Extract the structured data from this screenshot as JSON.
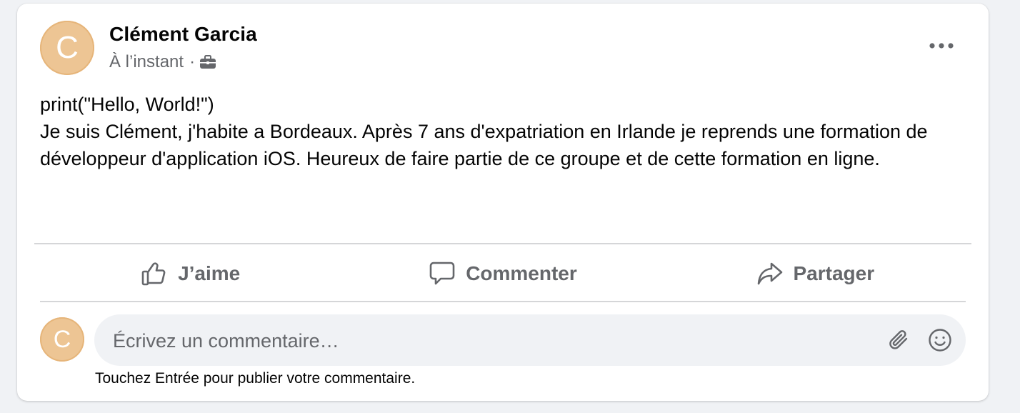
{
  "post": {
    "author": "Clément Garcia",
    "avatar_initial": "C",
    "timestamp": "À l’instant",
    "separator": "·",
    "audience_icon": "briefcase-icon",
    "text": "print(\"Hello, World!\")\nJe suis Clément, j'habite a Bordeaux. Après 7 ans d'expatriation en Irlande je reprends une formation de développeur d'application iOS. Heureux de faire partie de ce groupe et de cette formation en ligne.",
    "more_icon": "more-options-icon"
  },
  "actions": {
    "like": "J’aime",
    "comment": "Commenter",
    "share": "Partager"
  },
  "comment": {
    "avatar_initial": "C",
    "placeholder": "Écrivez un commentaire…",
    "value": "",
    "attach_icon": "paperclip-icon",
    "emoji_icon": "emoji-icon",
    "hint": "Touchez Entrée pour publier votre commentaire."
  },
  "colors": {
    "avatar": "#edc594",
    "secondary_text": "#65676b",
    "primary_text": "#050505",
    "input_bg": "#f0f2f5"
  }
}
